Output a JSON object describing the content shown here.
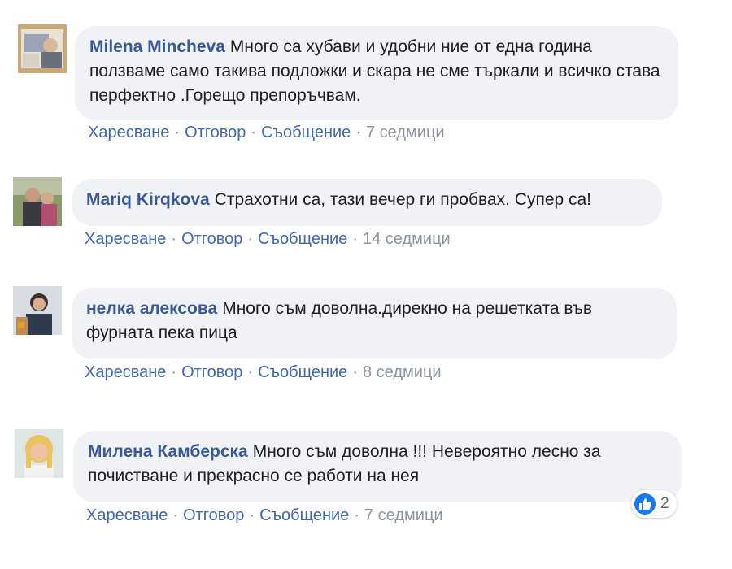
{
  "comments": [
    {
      "author": "Milena Mincheva",
      "text": "Много са хубави и удобни ние от една година ползваме само такива подложки и скара не сме търкали и всичко става перфектно .Горещо препоръчвам.",
      "like_label": "Харесване",
      "reply_label": "Отговор",
      "message_label": "Съобщение",
      "time": "7 седмици"
    },
    {
      "author": "Mariq Kirqkova",
      "text": "Страхотни са, тази вечер ги пробвах. Супер са!",
      "like_label": "Харесване",
      "reply_label": "Отговор",
      "message_label": "Съобщение",
      "time": "14 седмици"
    },
    {
      "author": "нелка алексова",
      "text": "Много съм доволна.дирекно на решетката във фурната пека пица",
      "like_label": "Харесване",
      "reply_label": "Отговор",
      "message_label": "Съобщение",
      "time": "8 седмици"
    },
    {
      "author": "Милена Камберска",
      "text": "Много съм доволна !!! Невероятно лесно за почистване и прекрасно се работи на нея",
      "like_label": "Харесване",
      "reply_label": "Отговор",
      "message_label": "Съобщение",
      "time": "7 седмици",
      "reactions": {
        "icon": "like-icon",
        "count": "2"
      }
    }
  ],
  "separator": "·",
  "colors": {
    "author": "#385898",
    "link": "#4267b2",
    "meta": "#8d949e",
    "bubble": "#f1f2f6",
    "like_badge": "#1877f2"
  }
}
